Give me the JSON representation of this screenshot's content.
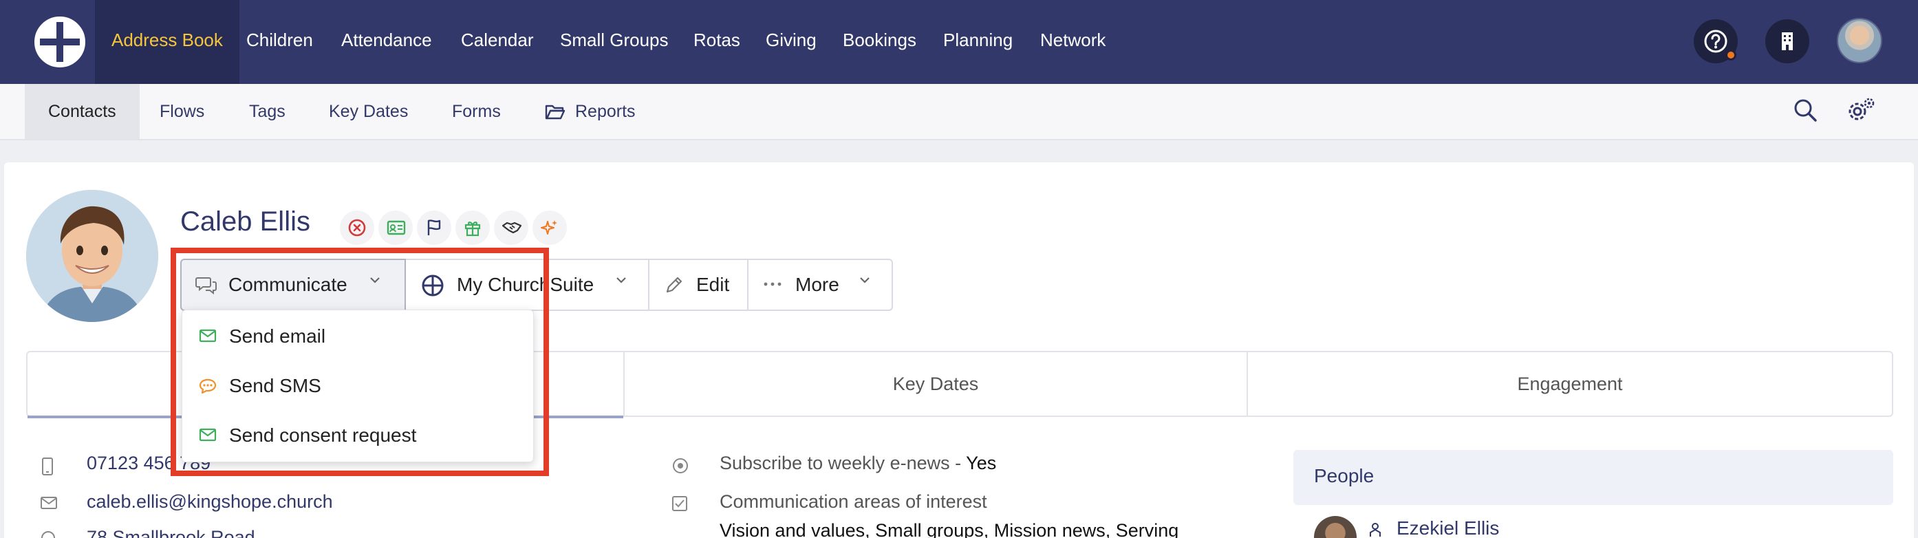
{
  "topnav": {
    "items": [
      "Address Book",
      "Children",
      "Attendance",
      "Calendar",
      "Small Groups",
      "Rotas",
      "Giving",
      "Bookings",
      "Planning",
      "Network"
    ],
    "active": "Address Book",
    "icons": [
      "help-icon",
      "building-icon",
      "user-avatar"
    ],
    "accent_color": "#f7c53b",
    "bar_color": "#32396a"
  },
  "subnav": {
    "items": [
      "Contacts",
      "Flows",
      "Tags",
      "Key Dates",
      "Forms",
      "Reports"
    ],
    "active": "Contacts",
    "icons": [
      "search-icon",
      "settings-icon"
    ]
  },
  "contact": {
    "name": "Caleb Ellis",
    "status_icons": [
      "remove-icon",
      "id-card-icon",
      "flag-icon",
      "gift-icon",
      "handshake-icon",
      "sparkle-icon"
    ]
  },
  "actions": {
    "communicate": "Communicate",
    "mychurchsuite": "My ChurchSuite",
    "edit": "Edit",
    "more": "More"
  },
  "dropdown": {
    "items": [
      {
        "label": "Send email",
        "icon": "envelope-icon",
        "color": "#3cae5c"
      },
      {
        "label": "Send SMS",
        "icon": "chat-icon",
        "color": "#f1912c"
      },
      {
        "label": "Send consent request",
        "icon": "envelope-icon",
        "color": "#3cae5c"
      }
    ]
  },
  "tabs": [
    "Key Dates",
    "Engagement"
  ],
  "details": {
    "phone": "07123 456 789",
    "email": "caleb.ellis@kingshope.church",
    "address_partial": "78 Smallbrook Road",
    "subscribe_label": "Subscribe to weekly e-news - ",
    "subscribe_value": "Yes",
    "comm_areas_label": "Communication areas of interest",
    "comm_areas_value": "Vision and values, Small groups, Mission news, Serving"
  },
  "people": {
    "title": "People",
    "first_person": "Ezekiel Ellis"
  },
  "highlight_color": "#e23d28"
}
